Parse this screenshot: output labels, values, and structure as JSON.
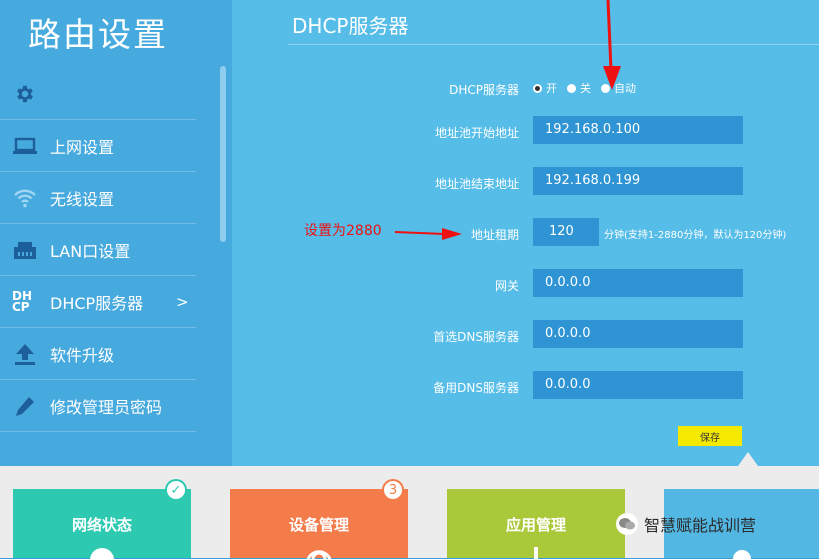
{
  "sidebar": {
    "title": "路由设置",
    "items": [
      {
        "icon": "gear-icon",
        "label": ""
      },
      {
        "icon": "laptop-icon",
        "label": "上网设置"
      },
      {
        "icon": "wifi-icon",
        "label": "无线设置"
      },
      {
        "icon": "network-port-icon",
        "label": "LAN口设置"
      },
      {
        "icon": "dhcp-icon",
        "icon_text": "DHCP",
        "label": "DHCP服务器",
        "arrow": ">"
      },
      {
        "icon": "upload-icon",
        "label": "软件升级"
      },
      {
        "icon": "pencil-icon",
        "label": "修改管理员密码"
      }
    ]
  },
  "main": {
    "title": "DHCP服务器",
    "dhcp": {
      "label": "DHCP服务器",
      "options": [
        "开",
        "关",
        "自动"
      ],
      "selected": "开"
    },
    "fields": {
      "start": {
        "label": "地址池开始地址",
        "value": "192.168.0.100"
      },
      "end": {
        "label": "地址池结束地址",
        "value": "192.168.0.199"
      },
      "lease": {
        "label": "地址租期",
        "value": "120",
        "hint": "分钟(支持1-2880分钟，默认为120分钟)"
      },
      "gateway": {
        "label": "网关",
        "value": "0.0.0.0"
      },
      "dns1": {
        "label": "首选DNS服务器",
        "value": "0.0.0.0"
      },
      "dns2": {
        "label": "备用DNS服务器",
        "value": "0.0.0.0"
      }
    },
    "save_label": "保存"
  },
  "annotation": {
    "text": "设置为2880",
    "color": "#e01010"
  },
  "tiles": [
    {
      "label": "网络状态",
      "color": "#2ec9b1",
      "badge": "✓"
    },
    {
      "label": "设备管理",
      "color": "#f47b4a",
      "badge": "3"
    },
    {
      "label": "应用管理",
      "color": "#a9c93a",
      "badge": ""
    },
    {
      "label": "",
      "color": "#53b7e4",
      "badge": ""
    }
  ],
  "watermark": "智慧赋能战训营",
  "colors": {
    "sidebar": "#47aade",
    "main": "#56bde8",
    "input": "#2f94d4",
    "save": "#f5e900"
  }
}
